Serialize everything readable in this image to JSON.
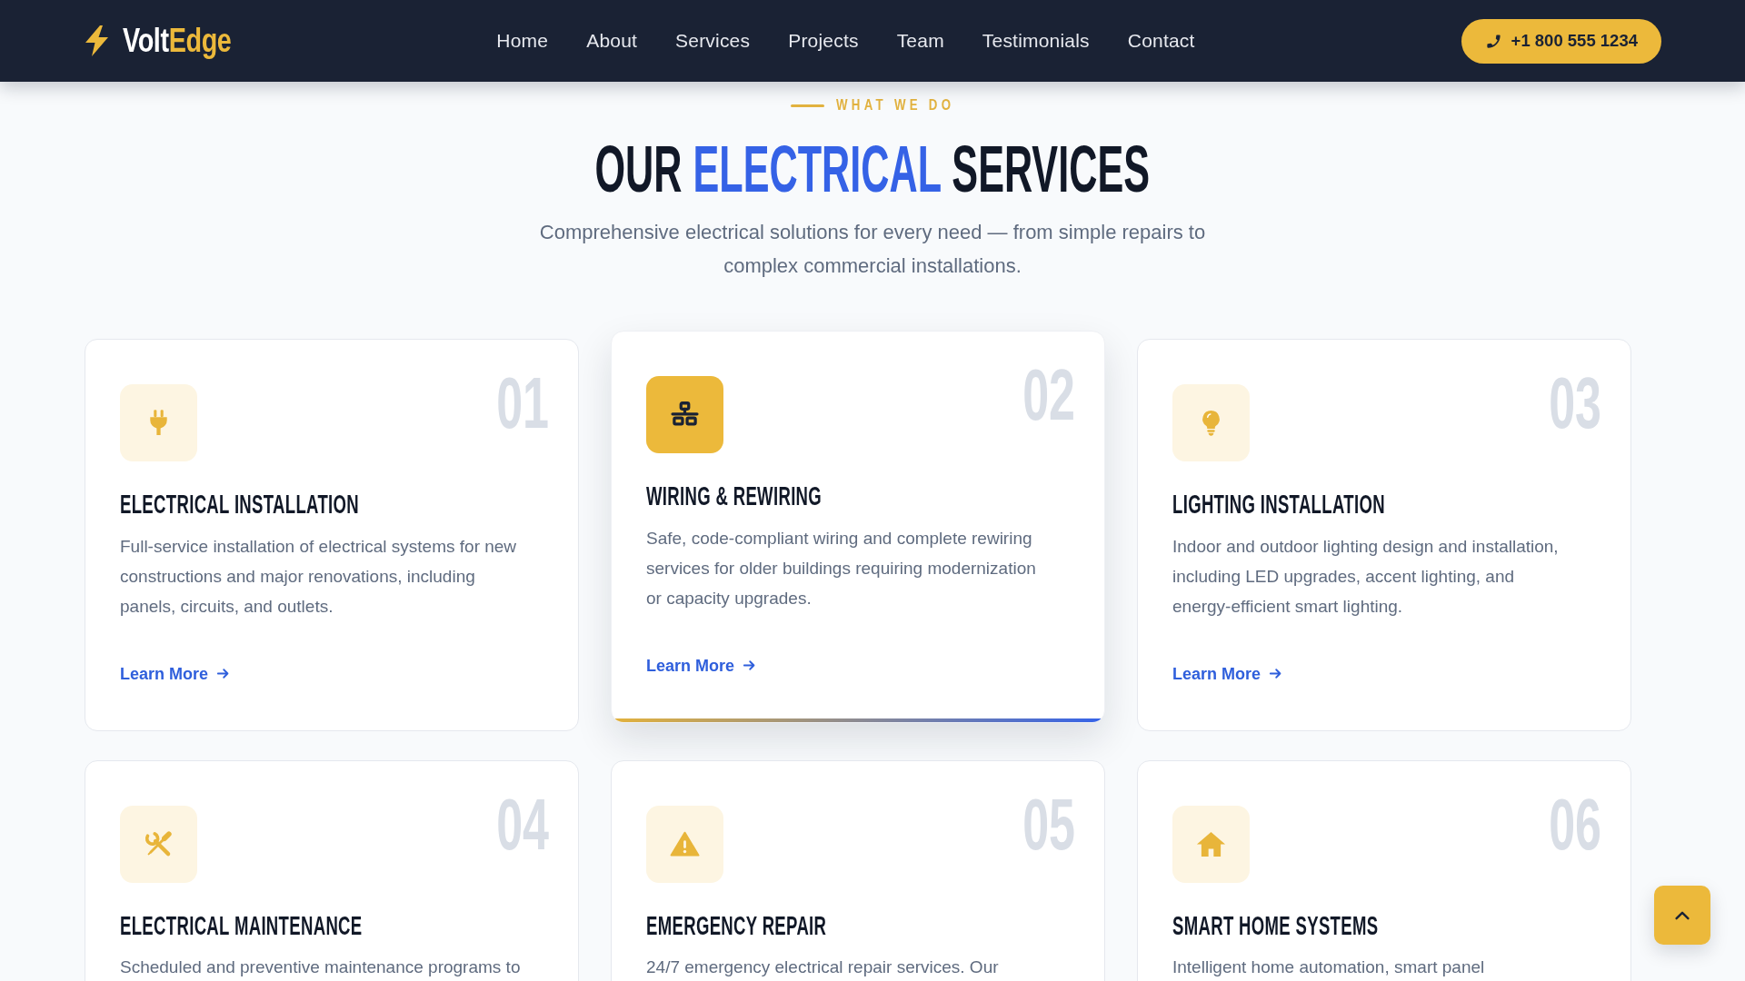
{
  "header": {
    "logo": {
      "text": "Volt",
      "accent": "Edge"
    },
    "nav": [
      "Home",
      "About",
      "Services",
      "Projects",
      "Team",
      "Testimonials",
      "Contact"
    ],
    "phone_button": "+1 800 555 1234"
  },
  "intro": {
    "eyebrow": "WHAT WE DO",
    "title": {
      "start": "OUR",
      "highlight": "ELECTRICAL",
      "end": "SERVICES"
    },
    "subtitle": "Comprehensive electrical solutions for every need — from simple repairs to complex commercial installations."
  },
  "services": [
    {
      "number": "01",
      "title": "ELECTRICAL INSTALLATION",
      "description": "Full-service installation of electrical systems for new constructions and major renovations, including panels, circuits, and outlets.",
      "link": "Learn More",
      "highlighted": false
    },
    {
      "number": "02",
      "title": "WIRING & REWIRING",
      "description": "Safe, code-compliant wiring and complete rewiring services for older buildings requiring modernization or capacity upgrades.",
      "link": "Learn More",
      "highlighted": true
    },
    {
      "number": "03",
      "title": "LIGHTING INSTALLATION",
      "description": "Indoor and outdoor lighting design and installation, including LED upgrades, accent lighting, and energy-efficient smart lighting.",
      "link": "Learn More",
      "highlighted": false
    },
    {
      "number": "04",
      "title": "ELECTRICAL MAINTENANCE",
      "description": "Scheduled and preventive maintenance programs to",
      "highlighted": false
    },
    {
      "number": "05",
      "title": "EMERGENCY REPAIR",
      "description": "24/7 emergency electrical repair services. Our",
      "highlighted": false
    },
    {
      "number": "06",
      "title": "SMART HOME SYSTEMS",
      "description": "Intelligent home automation, smart panel",
      "highlighted": false
    }
  ]
}
